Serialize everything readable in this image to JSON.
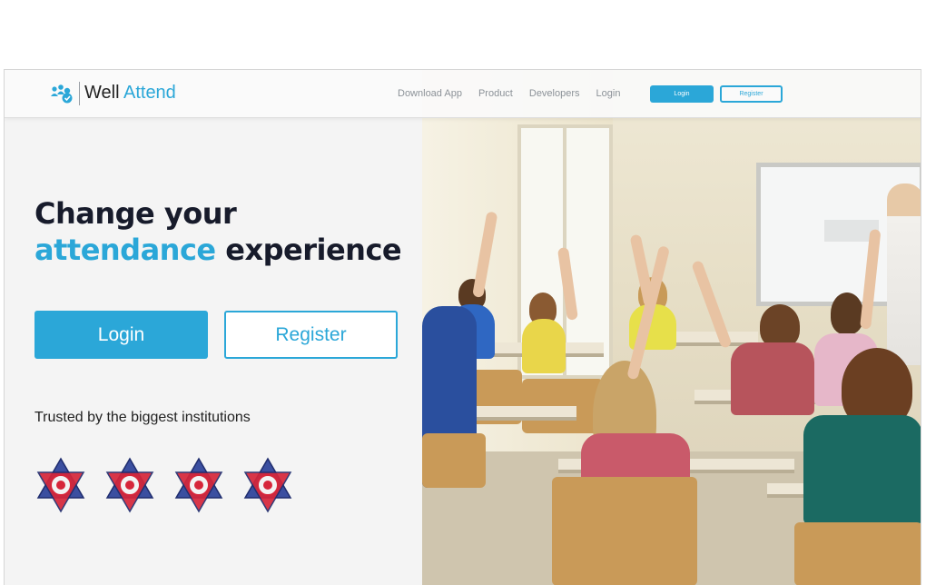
{
  "brand": {
    "name_primary": "Well",
    "name_accent": "Attend",
    "accent_color": "#2ba7d8",
    "logo_icon": "people-group-icon"
  },
  "nav": {
    "links": [
      "Download App",
      "Product",
      "Developers",
      "Login"
    ],
    "login_button": "Login",
    "register_button": "Register"
  },
  "hero": {
    "headline_line1": "Change your",
    "headline_accent": "attendance",
    "headline_rest": "experience",
    "login_button": "Login",
    "register_button": "Register",
    "trusted_text": "Trusted by the biggest institutions",
    "institution_badges": [
      "star-emblem-icon",
      "star-emblem-icon",
      "star-emblem-icon",
      "star-emblem-icon"
    ],
    "image": "classroom-photo"
  }
}
